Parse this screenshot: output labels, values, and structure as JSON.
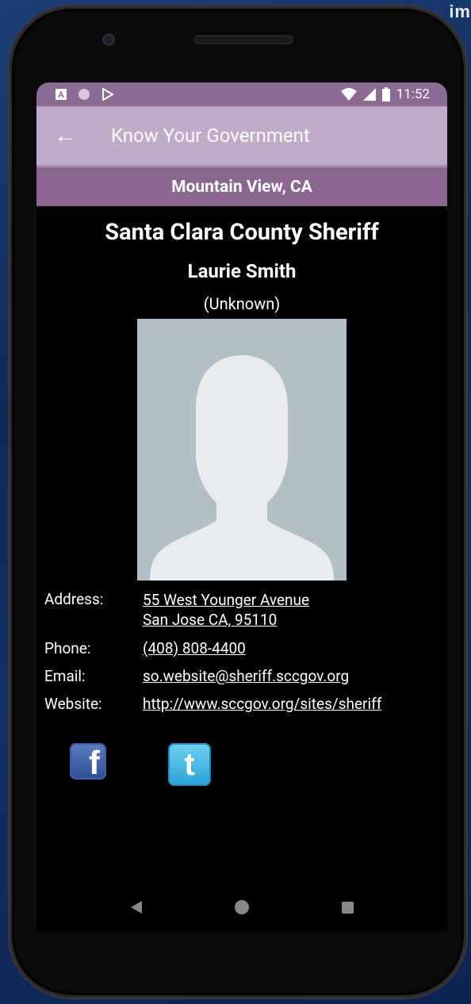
{
  "status_bar": {
    "time": "11:52"
  },
  "app_bar": {
    "title": "Know Your Government"
  },
  "location": "Mountain View, CA",
  "official": {
    "office": "Santa Clara County Sheriff",
    "name": "Laurie Smith",
    "party": "(Unknown)"
  },
  "details": {
    "address_label": "Address:",
    "address_line1": "55 West Younger Avenue",
    "address_line2": "San Jose CA, 95110",
    "phone_label": "Phone:",
    "phone": "(408) 808-4400",
    "email_label": "Email:",
    "email": "so.website@sheriff.sccgov.org",
    "website_label": "Website:",
    "website": "http://www.sccgov.org/sites/sheriff"
  },
  "social": {
    "facebook_letter": "f",
    "twitter_letter": "t"
  },
  "corner_text": "im"
}
